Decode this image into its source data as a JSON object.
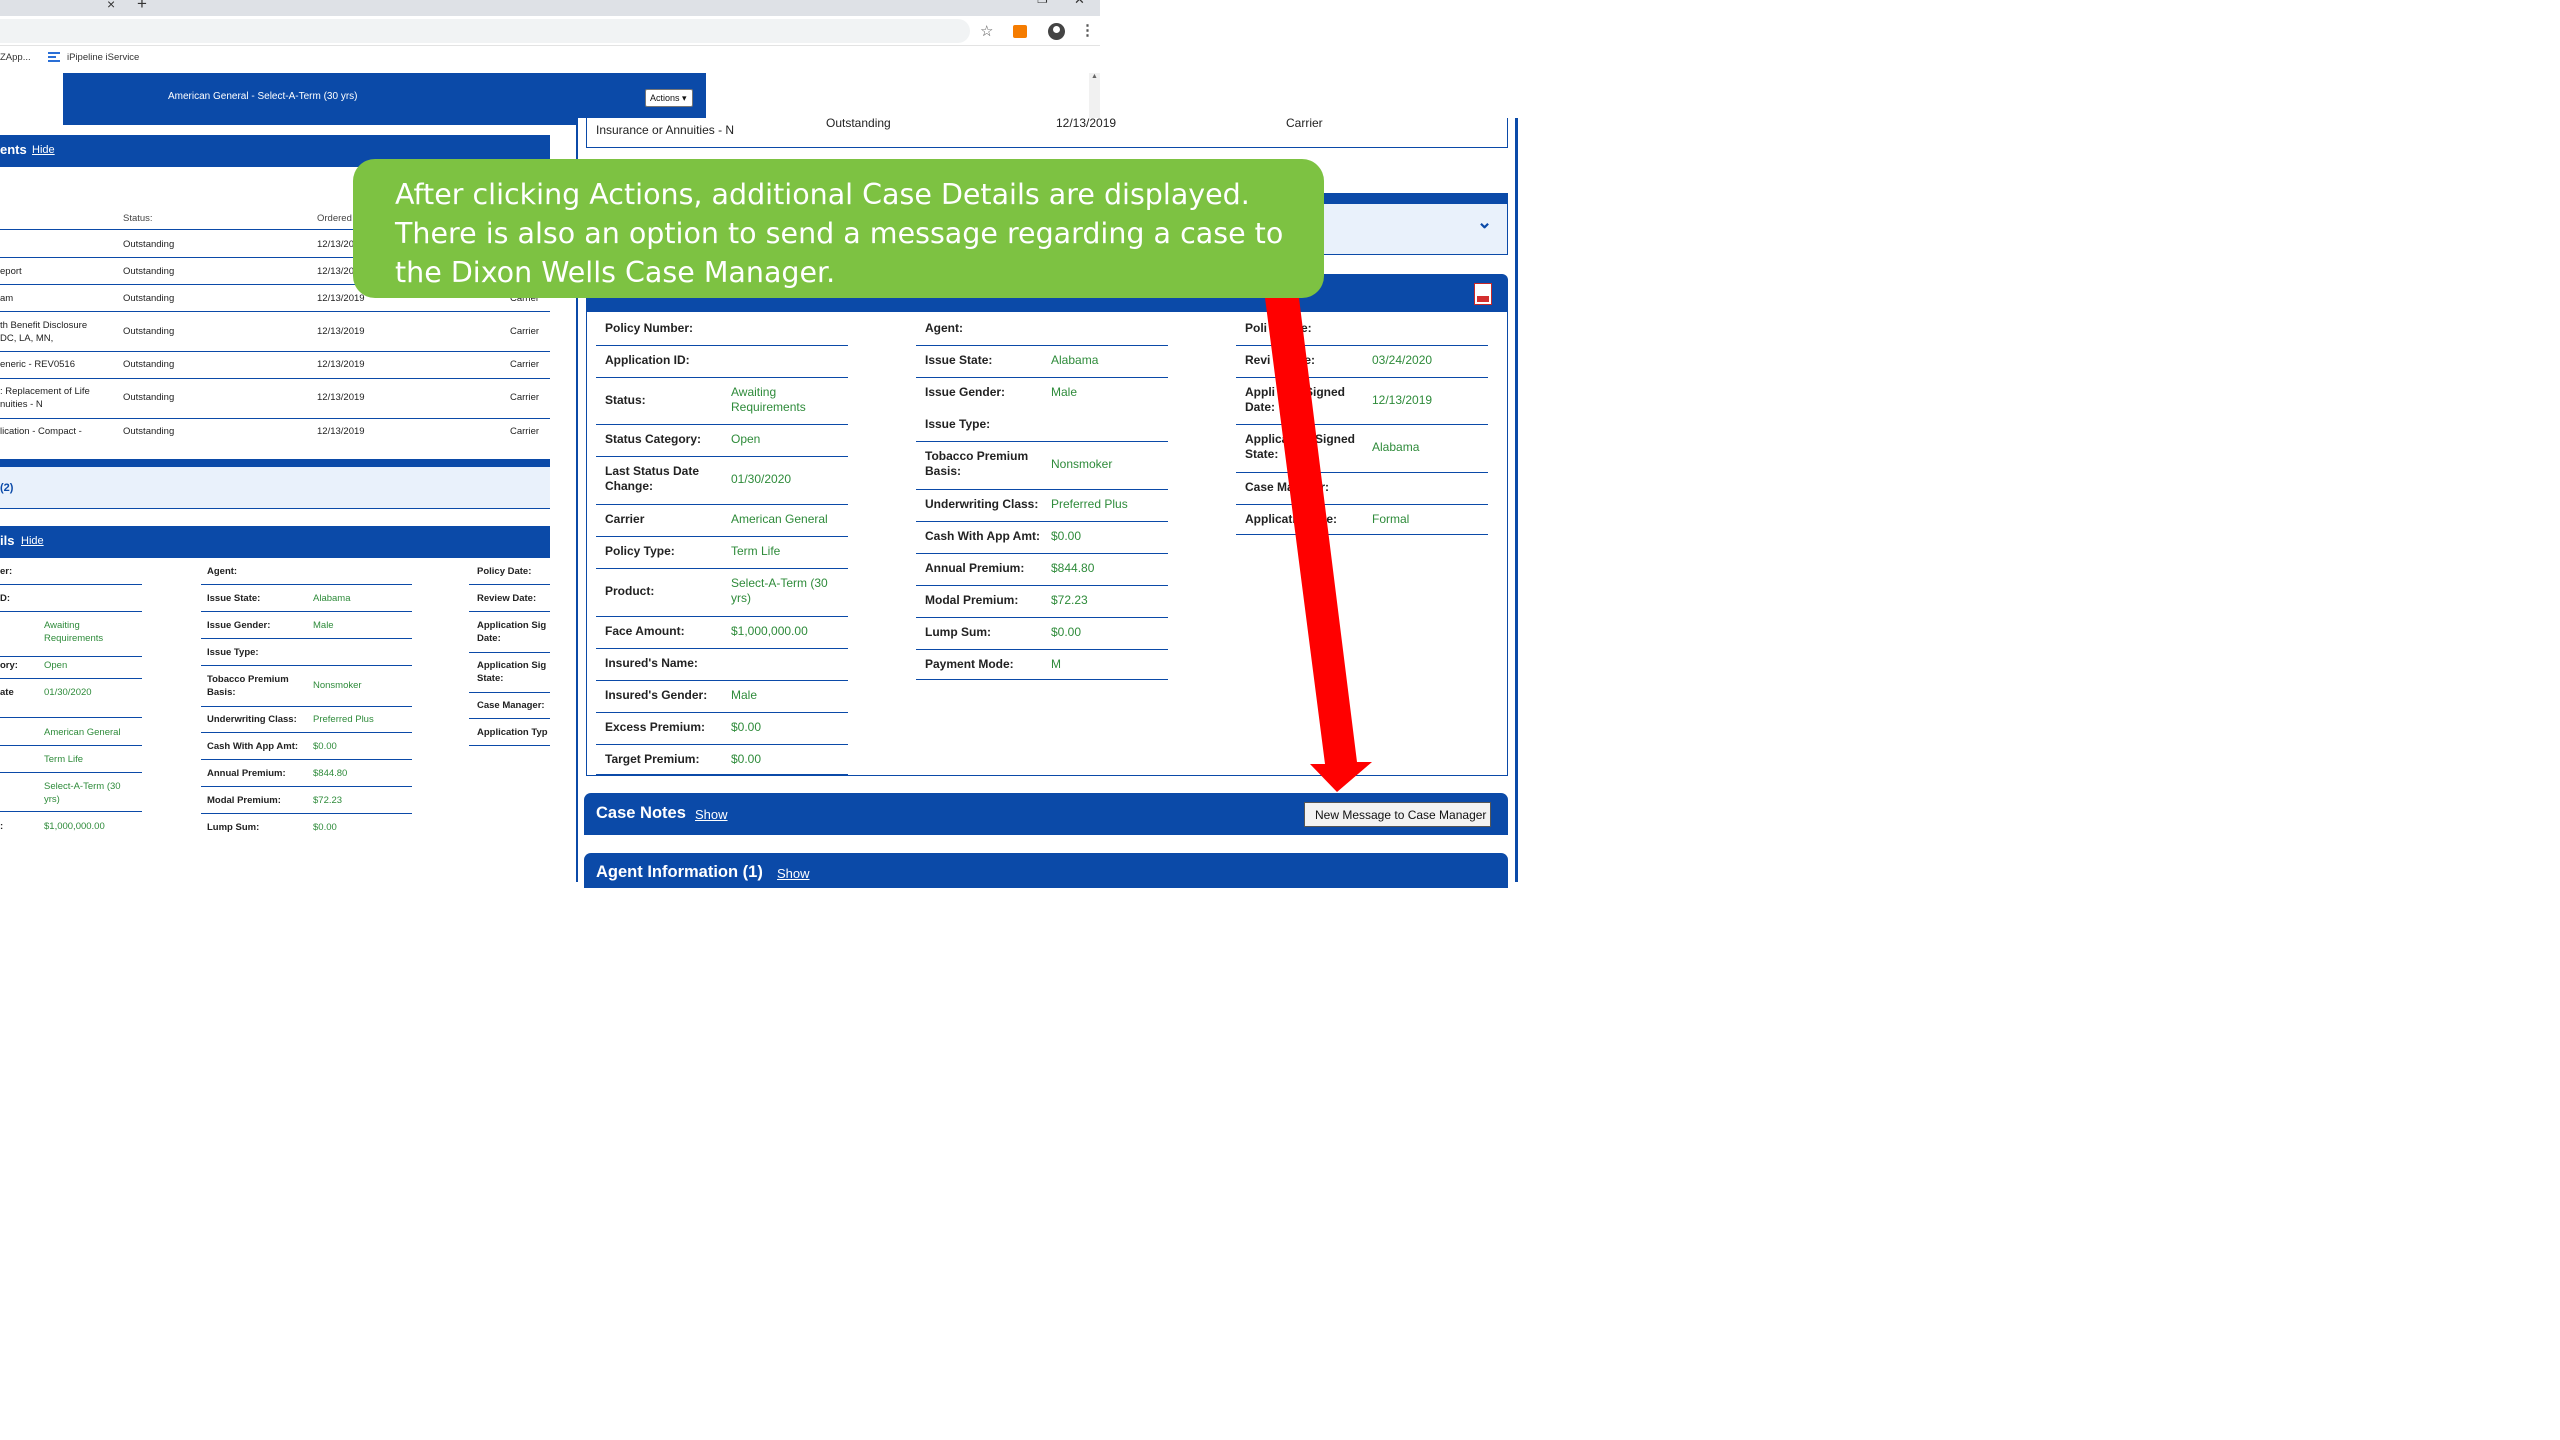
{
  "browser": {
    "new_tab_glyph": "+",
    "close_tab_glyph": "×",
    "window_controls": [
      "–",
      "❐",
      "✕"
    ],
    "bookmarks": [
      "ZApp...",
      "iPipeline iService"
    ],
    "icons": [
      "star-icon",
      "extension-icon",
      "account-icon",
      "menu-icon"
    ],
    "icon_colors": {
      "extension": "#f57c00"
    }
  },
  "page": {
    "header_title": "American General - Select-A-Term (30 yrs)",
    "actions_label": "Actions ▾",
    "requirements_title": "ents",
    "hide_label": "Hide",
    "status_col": "Status:",
    "ordered_col": "Ordered",
    "requirements": [
      {
        "name": "",
        "status": "Outstanding",
        "ordered": "12/13/20",
        "source": ""
      },
      {
        "name": "eport",
        "status": "Outstanding",
        "ordered": "12/13/20",
        "source": ""
      },
      {
        "name": "am",
        "status": "Outstanding",
        "ordered": "12/13/2019",
        "source": "Carrier"
      },
      {
        "name": "th Benefit Disclosure\nDC, LA, MN,",
        "status": "Outstanding",
        "ordered": "12/13/2019",
        "source": "Carrier"
      },
      {
        "name": "eneric - REV0516",
        "status": "Outstanding",
        "ordered": "12/13/2019",
        "source": "Carrier"
      },
      {
        "name": ": Replacement of Life\nnuities - N",
        "status": "Outstanding",
        "ordered": "12/13/2019",
        "source": "Carrier"
      },
      {
        "name": "lication - Compact -",
        "status": "Outstanding",
        "ordered": "12/13/2019",
        "source": "Carrier"
      }
    ],
    "count_label": "(2)",
    "details_title": "ils",
    "details_col1": [
      {
        "label": "er:",
        "value": ""
      },
      {
        "label": "D:",
        "value": ""
      },
      {
        "label": "",
        "value": "Awaiting\nRequirements"
      },
      {
        "label": "ory:",
        "value": "Open"
      },
      {
        "label": "ate",
        "value": "01/30/2020"
      },
      {
        "label": "",
        "value": "American General"
      },
      {
        "label": "",
        "value": "Term Life"
      },
      {
        "label": "",
        "value": "Select-A-Term (30\nyrs)"
      },
      {
        "label": ":",
        "value": "$1,000,000.00"
      }
    ],
    "details_col2": [
      {
        "label": "Agent:",
        "value": ""
      },
      {
        "label": "Issue State:",
        "value": "Alabama"
      },
      {
        "label": "Issue Gender:",
        "value": "Male"
      },
      {
        "label": "Issue Type:",
        "value": ""
      },
      {
        "label": "Tobacco Premium\nBasis:",
        "value": "Nonsmoker"
      },
      {
        "label": "Underwriting Class:",
        "value": "Preferred Plus"
      },
      {
        "label": "Cash With App Amt:",
        "value": "$0.00"
      },
      {
        "label": "Annual Premium:",
        "value": "$844.80"
      },
      {
        "label": "Modal Premium:",
        "value": "$72.23"
      },
      {
        "label": "Lump Sum:",
        "value": "$0.00"
      }
    ],
    "details_col3": [
      {
        "label": "Policy Date:"
      },
      {
        "label": "Review Date:"
      },
      {
        "label": "Application Sig\nDate:"
      },
      {
        "label": "Application Sig\nState:"
      },
      {
        "label": "Case Manager:"
      },
      {
        "label": "Application Typ"
      }
    ]
  },
  "zoom": {
    "top_row": {
      "name": "Insurance or Annuities - N",
      "status": "Outstanding",
      "ordered": "12/13/2019",
      "source": "Carrier"
    },
    "chevron": "⌄",
    "col1": [
      {
        "label": "Policy Number:",
        "value": ""
      },
      {
        "label": "Application ID:",
        "value": ""
      },
      {
        "label": "Status:",
        "value": "Awaiting\nRequirements"
      },
      {
        "label": "Status Category:",
        "value": "Open"
      },
      {
        "label": "Last Status Date\nChange:",
        "value": "01/30/2020"
      },
      {
        "label": "Carrier",
        "value": "American General"
      },
      {
        "label": "Policy Type:",
        "value": "Term Life"
      },
      {
        "label": "Product:",
        "value": "Select-A-Term (30\nyrs)"
      },
      {
        "label": "Face Amount:",
        "value": "$1,000,000.00"
      },
      {
        "label": "Insured's Name:",
        "value": ""
      },
      {
        "label": "Insured's Gender:",
        "value": "Male"
      },
      {
        "label": "Excess Premium:",
        "value": "$0.00"
      },
      {
        "label": "Target Premium:",
        "value": "$0.00"
      }
    ],
    "col2": [
      {
        "label": "Agent:",
        "value": ""
      },
      {
        "label": "Issue State:",
        "value": "Alabama"
      },
      {
        "label": "Issue Gender:",
        "value": "Male"
      },
      {
        "label": "Issue Type:",
        "value": ""
      },
      {
        "label": "Tobacco Premium\nBasis:",
        "value": "Nonsmoker"
      },
      {
        "label": "Underwriting Class:",
        "value": "Preferred Plus"
      },
      {
        "label": "Cash With App Amt:",
        "value": "$0.00"
      },
      {
        "label": "Annual Premium:",
        "value": "$844.80"
      },
      {
        "label": "Modal Premium:",
        "value": "$72.23"
      },
      {
        "label": "Lump Sum:",
        "value": "$0.00"
      },
      {
        "label": "Payment Mode:",
        "value": "M"
      }
    ],
    "col3": [
      {
        "label": "Poli         te:",
        "value": ""
      },
      {
        "label": "Revi         te:",
        "value": "03/24/2020"
      },
      {
        "label": "Appli         Signed\nDate:",
        "value": "12/13/2019"
      },
      {
        "label": "Applica        Signed\nState:",
        "value": "Alabama"
      },
      {
        "label": "Case Ma        r:",
        "value": ""
      },
      {
        "label": "Applicati       pe:",
        "value": "Formal"
      }
    ],
    "case_notes_title": "Case Notes",
    "show_label": "Show",
    "new_message_label": "New Message to Case Manager",
    "agent_info_title": "Agent Information (1)",
    "pdf_icon": "pdf-icon"
  },
  "callout_text": "After clicking Actions, additional Case Details are displayed. There is also an option to send a message regarding a case to the Dixon Wells Case Manager.",
  "colors": {
    "brand_blue": "#0b4aa8",
    "value_green": "#2e8b3a",
    "callout_green": "#7dc242",
    "arrow_red": "#ff0000"
  }
}
